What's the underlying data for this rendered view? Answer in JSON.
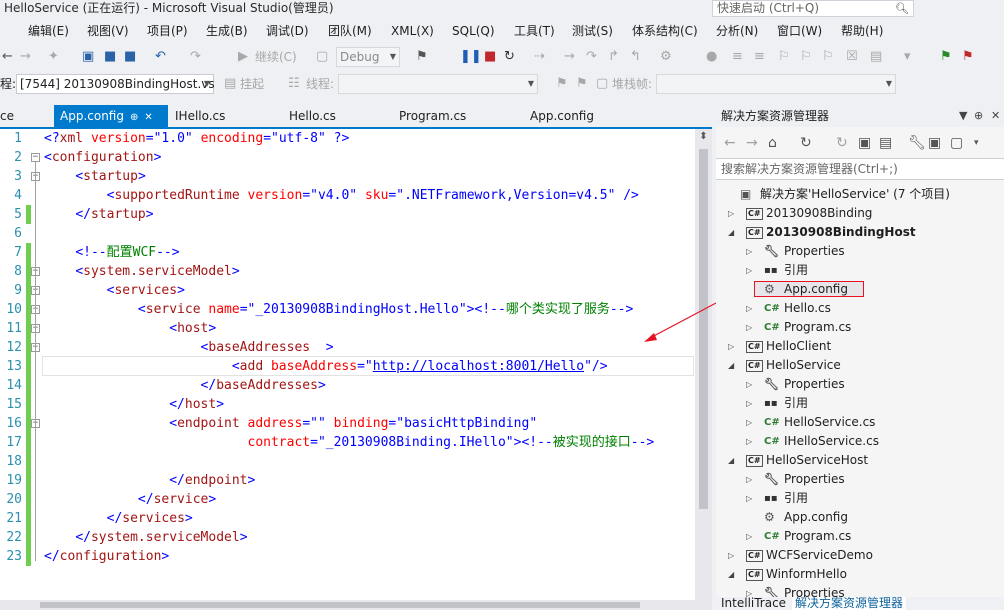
{
  "window": {
    "title": "HelloService (正在运行) - Microsoft Visual Studio(管理员)",
    "quick_launch_placeholder": "快速启动 (Ctrl+Q)"
  },
  "menu": [
    "编辑(E)",
    "视图(V)",
    "项目(P)",
    "生成(B)",
    "调试(D)",
    "团队(M)",
    "XML(X)",
    "SQL(Q)",
    "工具(T)",
    "测试(S)",
    "体系结构(C)",
    "分析(N)",
    "窗口(W)",
    "帮助(H)"
  ],
  "toolbar1": {
    "continue_label": "继续(C)",
    "config_value": "Debug"
  },
  "toolbar2": {
    "process_prefix": "程:",
    "process_value": "[7544] 20130908BindingHost.vs",
    "suspend_label": "挂起",
    "thread_label": "线程:",
    "stackframe_label": "堆栈帧:"
  },
  "editor_tabs": [
    {
      "label": "ce",
      "active": false
    },
    {
      "label": "App.config",
      "active": true
    },
    {
      "label": "IHello.cs",
      "active": false
    },
    {
      "label": "Hello.cs",
      "active": false
    },
    {
      "label": "Program.cs",
      "active": false
    },
    {
      "label": "App.config",
      "active": false
    }
  ],
  "code_lines": [
    {
      "n": "1",
      "tokens": [
        [
          "punc",
          "<?"
        ],
        [
          "tag",
          "xml"
        ],
        [
          "txt",
          " "
        ],
        [
          "attr",
          "version"
        ],
        [
          "punc",
          "=\""
        ],
        [
          "val",
          "1.0"
        ],
        [
          "punc",
          "\""
        ],
        [
          "txt",
          " "
        ],
        [
          "attr",
          "encoding"
        ],
        [
          "punc",
          "=\""
        ],
        [
          "val",
          "utf-8"
        ],
        [
          "punc",
          "\""
        ],
        [
          "txt",
          " "
        ],
        [
          "punc",
          "?>"
        ]
      ]
    },
    {
      "n": "2",
      "tokens": [
        [
          "punc",
          "<"
        ],
        [
          "tag",
          "configuration"
        ],
        [
          "punc",
          ">"
        ]
      ]
    },
    {
      "n": "3",
      "tokens": [
        [
          "txt",
          "    "
        ],
        [
          "punc",
          "<"
        ],
        [
          "tag",
          "startup"
        ],
        [
          "punc",
          ">"
        ]
      ]
    },
    {
      "n": "4",
      "tokens": [
        [
          "txt",
          "        "
        ],
        [
          "punc",
          "<"
        ],
        [
          "tag",
          "supportedRuntime"
        ],
        [
          "txt",
          " "
        ],
        [
          "attr",
          "version"
        ],
        [
          "punc",
          "=\""
        ],
        [
          "val",
          "v4.0"
        ],
        [
          "punc",
          "\""
        ],
        [
          "txt",
          " "
        ],
        [
          "attr",
          "sku"
        ],
        [
          "punc",
          "=\""
        ],
        [
          "val",
          ".NETFramework,Version=v4.5"
        ],
        [
          "punc",
          "\""
        ],
        [
          "txt",
          " "
        ],
        [
          "punc",
          "/>"
        ]
      ]
    },
    {
      "n": "5",
      "tokens": [
        [
          "txt",
          "    "
        ],
        [
          "punc",
          "</"
        ],
        [
          "tag",
          "startup"
        ],
        [
          "punc",
          ">"
        ]
      ]
    },
    {
      "n": "6",
      "tokens": []
    },
    {
      "n": "7",
      "tokens": [
        [
          "txt",
          "    "
        ],
        [
          "punc",
          "<!--"
        ],
        [
          "cmt",
          "配置WCF"
        ],
        [
          "punc",
          "-->"
        ]
      ]
    },
    {
      "n": "8",
      "tokens": [
        [
          "txt",
          "    "
        ],
        [
          "punc",
          "<"
        ],
        [
          "tag",
          "system.serviceModel"
        ],
        [
          "punc",
          ">"
        ]
      ]
    },
    {
      "n": "9",
      "tokens": [
        [
          "txt",
          "        "
        ],
        [
          "punc",
          "<"
        ],
        [
          "tag",
          "services"
        ],
        [
          "punc",
          ">"
        ]
      ]
    },
    {
      "n": "10",
      "tokens": [
        [
          "txt",
          "            "
        ],
        [
          "punc",
          "<"
        ],
        [
          "tag",
          "service"
        ],
        [
          "txt",
          " "
        ],
        [
          "attr",
          "name"
        ],
        [
          "punc",
          "=\""
        ],
        [
          "val",
          "_20130908BindingHost.Hello"
        ],
        [
          "punc",
          "\">"
        ],
        [
          "punc",
          "<!--"
        ],
        [
          "cmt",
          "哪个类实现了服务"
        ],
        [
          "punc",
          "-->"
        ]
      ]
    },
    {
      "n": "11",
      "tokens": [
        [
          "txt",
          "                "
        ],
        [
          "punc",
          "<"
        ],
        [
          "tag",
          "host"
        ],
        [
          "punc",
          ">"
        ]
      ]
    },
    {
      "n": "12",
      "tokens": [
        [
          "txt",
          "                    "
        ],
        [
          "punc",
          "<"
        ],
        [
          "tag",
          "baseAddresses"
        ],
        [
          "txt",
          "  "
        ],
        [
          "punc",
          ">"
        ]
      ]
    },
    {
      "n": "13",
      "tokens": [
        [
          "txt",
          "                        "
        ],
        [
          "punc",
          "<"
        ],
        [
          "tag",
          "add"
        ],
        [
          "txt",
          " "
        ],
        [
          "attr",
          "baseAddress"
        ],
        [
          "punc",
          "=\""
        ],
        [
          "url",
          "http://localhost:8001/Hello"
        ],
        [
          "punc",
          "\"/>"
        ]
      ]
    },
    {
      "n": "14",
      "tokens": [
        [
          "txt",
          "                    "
        ],
        [
          "punc",
          "</"
        ],
        [
          "tag",
          "baseAddresses"
        ],
        [
          "punc",
          ">"
        ]
      ]
    },
    {
      "n": "15",
      "tokens": [
        [
          "txt",
          "                "
        ],
        [
          "punc",
          "</"
        ],
        [
          "tag",
          "host"
        ],
        [
          "punc",
          ">"
        ]
      ]
    },
    {
      "n": "16",
      "tokens": [
        [
          "txt",
          "                "
        ],
        [
          "punc",
          "<"
        ],
        [
          "tag",
          "endpoint"
        ],
        [
          "txt",
          " "
        ],
        [
          "attr",
          "address"
        ],
        [
          "punc",
          "=\"\""
        ],
        [
          "txt",
          " "
        ],
        [
          "attr",
          "binding"
        ],
        [
          "punc",
          "=\""
        ],
        [
          "val",
          "basicHttpBinding"
        ],
        [
          "punc",
          "\""
        ]
      ]
    },
    {
      "n": "17",
      "tokens": [
        [
          "txt",
          "                          "
        ],
        [
          "attr",
          "contract"
        ],
        [
          "punc",
          "=\""
        ],
        [
          "val",
          "_20130908Binding.IHello"
        ],
        [
          "punc",
          "\">"
        ],
        [
          "punc",
          "<!--"
        ],
        [
          "cmt",
          "被实现的接口"
        ],
        [
          "punc",
          "-->"
        ]
      ]
    },
    {
      "n": "18",
      "tokens": []
    },
    {
      "n": "19",
      "tokens": [
        [
          "txt",
          "                "
        ],
        [
          "punc",
          "</"
        ],
        [
          "tag",
          "endpoint"
        ],
        [
          "punc",
          ">"
        ]
      ]
    },
    {
      "n": "20",
      "tokens": [
        [
          "txt",
          "            "
        ],
        [
          "punc",
          "</"
        ],
        [
          "tag",
          "service"
        ],
        [
          "punc",
          ">"
        ]
      ]
    },
    {
      "n": "21",
      "tokens": [
        [
          "txt",
          "        "
        ],
        [
          "punc",
          "</"
        ],
        [
          "tag",
          "services"
        ],
        [
          "punc",
          ">"
        ]
      ]
    },
    {
      "n": "22",
      "tokens": [
        [
          "txt",
          "    "
        ],
        [
          "punc",
          "</"
        ],
        [
          "tag",
          "system.serviceModel"
        ],
        [
          "punc",
          ">"
        ]
      ]
    },
    {
      "n": "23",
      "tokens": [
        [
          "punc",
          "</"
        ],
        [
          "tag",
          "configuration"
        ],
        [
          "punc",
          ">"
        ]
      ]
    }
  ],
  "solution_explorer": {
    "title": "解决方案资源管理器",
    "search_placeholder": "搜索解决方案资源管理器(Ctrl+;)",
    "tree": [
      {
        "label": "解决方案'HelloService' (7 个项目)",
        "icon": "solution-icon",
        "depth": 0,
        "expander": "",
        "bold": false
      },
      {
        "label": "20130908Binding",
        "icon": "csharp-project-icon",
        "depth": 1,
        "expander": "collapsed",
        "bold": false
      },
      {
        "label": "20130908BindingHost",
        "icon": "csharp-project-icon",
        "depth": 1,
        "expander": "expanded",
        "bold": true
      },
      {
        "label": "Properties",
        "icon": "wrench-icon",
        "depth": 2,
        "expander": "collapsed",
        "bold": false
      },
      {
        "label": "引用",
        "icon": "references-icon",
        "depth": 2,
        "expander": "collapsed",
        "bold": false
      },
      {
        "label": "App.config",
        "icon": "config-file-icon",
        "depth": 2,
        "expander": "",
        "bold": false
      },
      {
        "label": "Hello.cs",
        "icon": "csharp-file-icon",
        "depth": 2,
        "expander": "collapsed",
        "bold": false
      },
      {
        "label": "Program.cs",
        "icon": "csharp-file-icon",
        "depth": 2,
        "expander": "collapsed",
        "bold": false
      },
      {
        "label": "HelloClient",
        "icon": "csharp-project-icon",
        "depth": 1,
        "expander": "collapsed",
        "bold": false
      },
      {
        "label": "HelloService",
        "icon": "csharp-project-icon",
        "depth": 1,
        "expander": "expanded",
        "bold": false
      },
      {
        "label": "Properties",
        "icon": "wrench-icon",
        "depth": 2,
        "expander": "collapsed",
        "bold": false
      },
      {
        "label": "引用",
        "icon": "references-icon",
        "depth": 2,
        "expander": "collapsed",
        "bold": false
      },
      {
        "label": "HelloService.cs",
        "icon": "csharp-file-icon",
        "depth": 2,
        "expander": "collapsed",
        "bold": false
      },
      {
        "label": "IHelloService.cs",
        "icon": "csharp-file-icon",
        "depth": 2,
        "expander": "collapsed",
        "bold": false
      },
      {
        "label": "HelloServiceHost",
        "icon": "csharp-project-icon",
        "depth": 1,
        "expander": "expanded",
        "bold": false
      },
      {
        "label": "Properties",
        "icon": "wrench-icon",
        "depth": 2,
        "expander": "collapsed",
        "bold": false
      },
      {
        "label": "引用",
        "icon": "references-icon",
        "depth": 2,
        "expander": "collapsed",
        "bold": false
      },
      {
        "label": "App.config",
        "icon": "config-file-icon",
        "depth": 2,
        "expander": "",
        "bold": false
      },
      {
        "label": "Program.cs",
        "icon": "csharp-file-icon",
        "depth": 2,
        "expander": "collapsed",
        "bold": false
      },
      {
        "label": "WCFServiceDemo",
        "icon": "csharp-project-icon",
        "depth": 1,
        "expander": "collapsed",
        "bold": false
      },
      {
        "label": "WinformHello",
        "icon": "csharp-project-icon",
        "depth": 1,
        "expander": "expanded",
        "bold": false
      },
      {
        "label": "Properties",
        "icon": "wrench-icon",
        "depth": 2,
        "expander": "collapsed",
        "bold": false
      }
    ],
    "bottom_tabs": [
      {
        "label": "IntelliTrace",
        "active": false
      },
      {
        "label": "解决方案资源管理器",
        "active": true
      }
    ]
  },
  "colors": {
    "accent": "#007acc",
    "xml_tag": "#a31515",
    "xml_attr": "#ff0000",
    "xml_value": "#0000ff",
    "comment": "#008000",
    "line_number": "#2b91af",
    "change_bar": "#6fcd4f",
    "annotation_red": "#e81123"
  }
}
